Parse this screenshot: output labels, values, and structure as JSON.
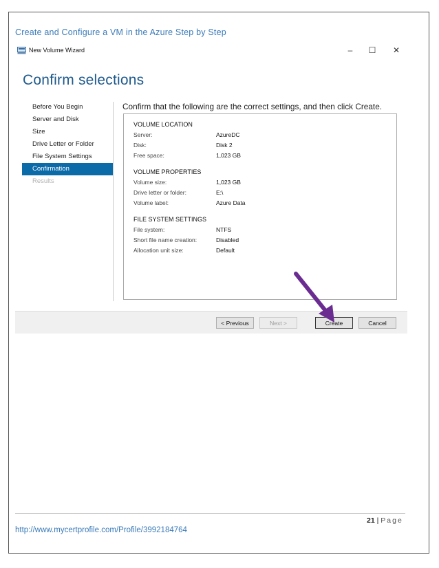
{
  "doc": {
    "header": "Create and Configure a VM in the Azure Step by Step",
    "page_number": "21",
    "page_separator": "|",
    "page_word": "Page",
    "footer_url": "http://www.mycertprofile.com/Profile/3992184764"
  },
  "window": {
    "title": "New Volume Wizard",
    "icon": "volume-wizard-icon",
    "controls": {
      "minimize": "–",
      "maximize": "☐",
      "close": "✕"
    }
  },
  "wizard": {
    "heading": "Confirm selections",
    "nav": [
      {
        "label": "Before You Begin",
        "state": "normal"
      },
      {
        "label": "Server and Disk",
        "state": "normal"
      },
      {
        "label": "Size",
        "state": "normal"
      },
      {
        "label": "Drive Letter or Folder",
        "state": "normal"
      },
      {
        "label": "File System Settings",
        "state": "normal"
      },
      {
        "label": "Confirmation",
        "state": "active"
      },
      {
        "label": "Results",
        "state": "disabled"
      }
    ],
    "instruction": "Confirm that the following are the correct settings, and then click Create.",
    "sections": [
      {
        "title": "VOLUME LOCATION",
        "rows": [
          {
            "label": "Server:",
            "value": "AzureDC"
          },
          {
            "label": "Disk:",
            "value": "Disk 2"
          },
          {
            "label": "Free space:",
            "value": "1,023 GB"
          }
        ]
      },
      {
        "title": "VOLUME PROPERTIES",
        "rows": [
          {
            "label": "Volume size:",
            "value": "1,023 GB"
          },
          {
            "label": "Drive letter or folder:",
            "value": "E:\\"
          },
          {
            "label": "Volume label:",
            "value": "Azure Data"
          }
        ]
      },
      {
        "title": "FILE SYSTEM SETTINGS",
        "rows": [
          {
            "label": "File system:",
            "value": "NTFS"
          },
          {
            "label": "Short file name creation:",
            "value": "Disabled"
          },
          {
            "label": "Allocation unit size:",
            "value": "Default"
          }
        ]
      }
    ],
    "buttons": {
      "previous": "< Previous",
      "next": "Next >",
      "create": "Create",
      "cancel": "Cancel"
    }
  },
  "colors": {
    "accent": "#0b6aa8",
    "heading": "#1e5a8c",
    "doc_link": "#3a7ab8",
    "arrow": "#6a2c91"
  }
}
